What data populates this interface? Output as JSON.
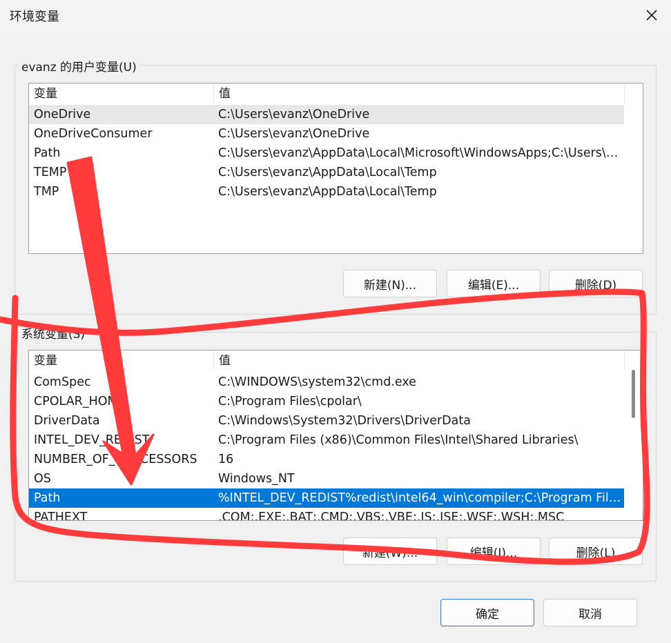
{
  "window": {
    "title": "环境变量"
  },
  "user_vars": {
    "group_label": "evanz 的用户变量(U)",
    "columns": [
      "变量",
      "值"
    ],
    "rows": [
      {
        "name": "OneDrive",
        "value": "C:\\Users\\evanz\\OneDrive"
      },
      {
        "name": "OneDriveConsumer",
        "value": "C:\\Users\\evanz\\OneDrive"
      },
      {
        "name": "Path",
        "value": "C:\\Users\\evanz\\AppData\\Local\\Microsoft\\WindowsApps;C:\\Users\\e..."
      },
      {
        "name": "TEMP",
        "value": "C:\\Users\\evanz\\AppData\\Local\\Temp"
      },
      {
        "name": "TMP",
        "value": "C:\\Users\\evanz\\AppData\\Local\\Temp"
      }
    ],
    "buttons": {
      "new": "新建(N)...",
      "edit": "编辑(E)...",
      "delete": "删除(D)"
    }
  },
  "system_vars": {
    "group_label": "系统变量(S)",
    "columns": [
      "变量",
      "值"
    ],
    "rows": [
      {
        "name": "ComSpec",
        "value": "C:\\WINDOWS\\system32\\cmd.exe"
      },
      {
        "name": "CPOLAR_HOME",
        "value": "C:\\Program Files\\cpolar\\"
      },
      {
        "name": "DriverData",
        "value": "C:\\Windows\\System32\\Drivers\\DriverData"
      },
      {
        "name": "INTEL_DEV_REDIST",
        "value": "C:\\Program Files (x86)\\Common Files\\Intel\\Shared Libraries\\"
      },
      {
        "name": "NUMBER_OF_PROCESSORS",
        "value": "16"
      },
      {
        "name": "OS",
        "value": "Windows_NT"
      },
      {
        "name": "Path",
        "value": "%INTEL_DEV_REDIST%redist\\intel64_win\\compiler;C:\\Program File..."
      },
      {
        "name": "PATHEXT",
        "value": ".COM;.EXE;.BAT;.CMD;.VBS;.VBE;.JS;.JSE;.WSF;.WSH;.MSC"
      }
    ],
    "buttons": {
      "new": "新建(W)...",
      "edit": "编辑(I)...",
      "delete": "删除(L)"
    }
  },
  "footer": {
    "ok": "确定",
    "cancel": "取消"
  },
  "colors": {
    "selection": "#0078d7",
    "annotation": "#ff3b3b"
  },
  "icons": {
    "close": "close-icon"
  }
}
